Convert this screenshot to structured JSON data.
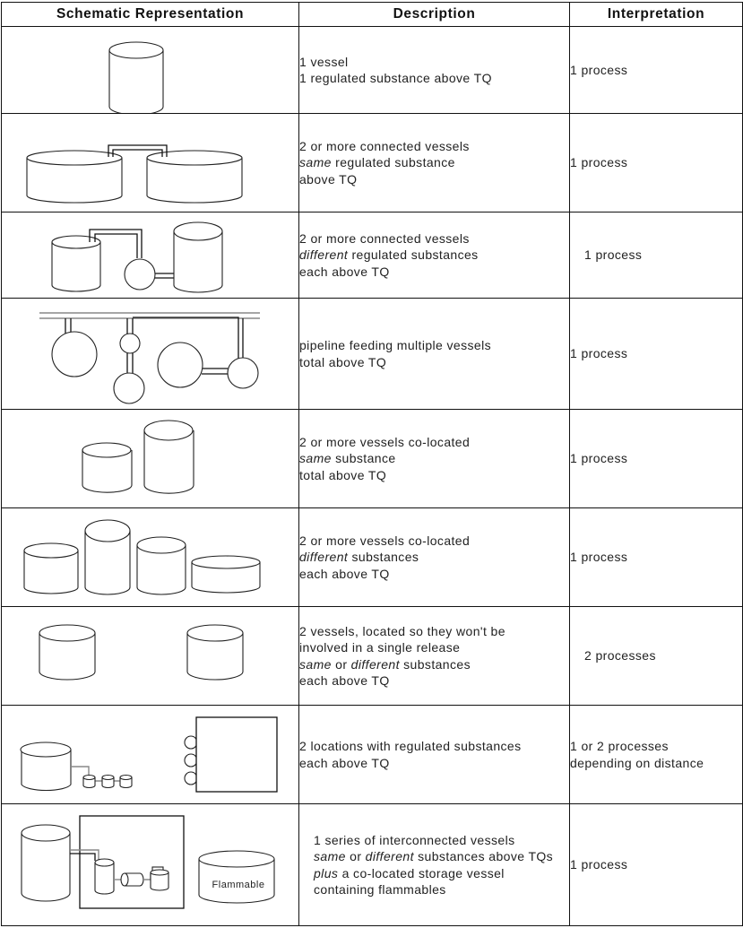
{
  "table": {
    "headers": {
      "schematic": "Schematic Representation",
      "description": "Description",
      "interpretation": "Interpretation"
    },
    "rows": [
      {
        "schematic": "single-vessel",
        "description": [
          [
            {
              "t": "1 vessel"
            }
          ],
          [
            {
              "t": "1 regulated substance above TQ"
            }
          ]
        ],
        "interpretation": [
          "1 process"
        ]
      },
      {
        "schematic": "two-connected-vessels-same",
        "description": [
          [
            {
              "t": "2 or more connected vessels"
            }
          ],
          [
            {
              "t": "same",
              "i": true
            },
            {
              "t": " regulated substance"
            }
          ],
          [
            {
              "t": "above TQ"
            }
          ]
        ],
        "interpretation": [
          "1 process"
        ]
      },
      {
        "schematic": "connected-vessels-different",
        "description": [
          [
            {
              "t": "2 or more connected vessels"
            }
          ],
          [
            {
              "t": "different",
              "i": true
            },
            {
              "t": " regulated substances"
            }
          ],
          [
            {
              "t": "each above TQ"
            }
          ]
        ],
        "interpretation": [
          "1 process"
        ]
      },
      {
        "schematic": "pipeline-multiple-vessels",
        "description": [
          [
            {
              "t": "pipeline feeding multiple vessels"
            }
          ],
          [
            {
              "t": "total above TQ"
            }
          ]
        ],
        "interpretation": [
          "1 process"
        ]
      },
      {
        "schematic": "co-located-same",
        "description": [
          [
            {
              "t": "2 or more vessels co-located"
            }
          ],
          [
            {
              "t": "same",
              "i": true
            },
            {
              "t": " substance"
            }
          ],
          [
            {
              "t": "total above TQ"
            }
          ]
        ],
        "interpretation": [
          "1 process"
        ]
      },
      {
        "schematic": "co-located-different",
        "description": [
          [
            {
              "t": "2 or more vessels co-located"
            }
          ],
          [
            {
              "t": "different",
              "i": true
            },
            {
              "t": " substances"
            }
          ],
          [
            {
              "t": "each above TQ"
            }
          ]
        ],
        "interpretation": [
          "1 process"
        ]
      },
      {
        "schematic": "separated-vessels",
        "description": [
          [
            {
              "t": "2 vessels, located so they won't be"
            }
          ],
          [
            {
              "t": "involved in a single release"
            }
          ],
          [
            {
              "t": "same",
              "i": true
            },
            {
              "t": " or "
            },
            {
              "t": "different",
              "i": true
            },
            {
              "t": " substances"
            }
          ],
          [
            {
              "t": "each above TQ"
            }
          ]
        ],
        "interpretation": [
          "2 processes"
        ]
      },
      {
        "schematic": "two-locations",
        "description": [
          [
            {
              "t": "2 locations with regulated substances"
            }
          ],
          [
            {
              "t": "each above TQ"
            }
          ]
        ],
        "interpretation": [
          "1 or 2 processes",
          "depending on distance"
        ]
      },
      {
        "schematic": "interconnected-series-plus-flammable",
        "schematic_label": "Flammable",
        "description": [
          [
            {
              "t": "1 series of interconnected vessels"
            }
          ],
          [
            {
              "t": "same",
              "i": true
            },
            {
              "t": " or "
            },
            {
              "t": "different",
              "i": true
            },
            {
              "t": " substances above TQs"
            }
          ],
          [
            {
              "t": "plus",
              "i": true
            },
            {
              "t": " a co-located storage vessel"
            }
          ],
          [
            {
              "t": "containing flammables"
            }
          ]
        ],
        "interpretation": [
          "1 process"
        ]
      }
    ]
  }
}
